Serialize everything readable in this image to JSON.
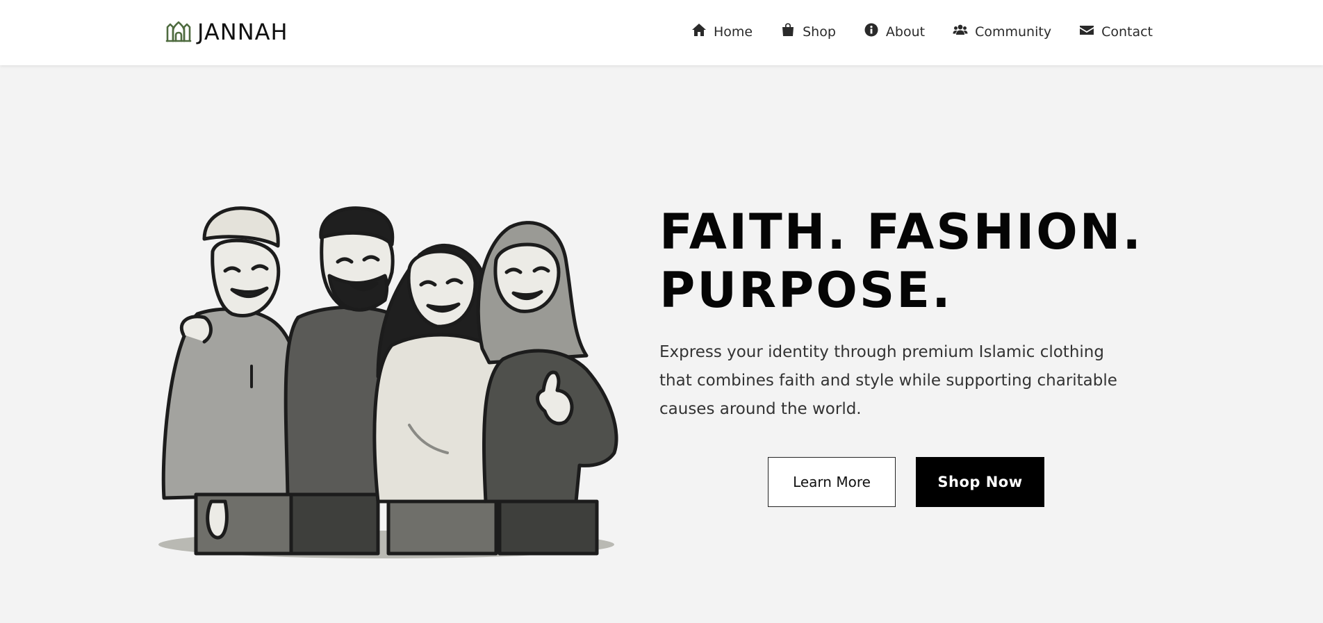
{
  "brand": {
    "name": "JANNAH",
    "logo_icon": "mosque-icon",
    "logo_color": "#4e6b3f"
  },
  "nav": {
    "items": [
      {
        "label": "Home",
        "icon": "home-icon"
      },
      {
        "label": "Shop",
        "icon": "shopping-bag-icon"
      },
      {
        "label": "About",
        "icon": "info-circle-icon"
      },
      {
        "label": "Community",
        "icon": "users-icon"
      },
      {
        "label": "Contact",
        "icon": "envelope-icon"
      }
    ]
  },
  "hero": {
    "headline_line1": "FAITH. FASHION.",
    "headline_line2": "PURPOSE.",
    "description": "Express your identity through premium Islamic clothing that combines faith and style while supporting charitable causes around the world.",
    "learn_more_label": "Learn More",
    "shop_now_label": "Shop Now"
  },
  "colors": {
    "page_background": "#f3f3f3",
    "header_background": "#ffffff",
    "primary_button": "#000000",
    "text": "#111111"
  }
}
